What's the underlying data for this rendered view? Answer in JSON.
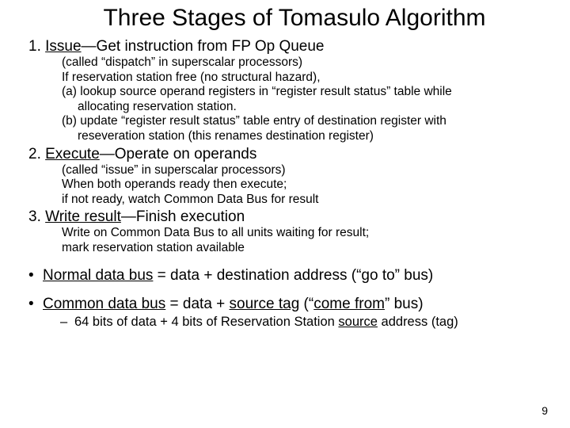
{
  "title": "Three Stages of Tomasulo Algorithm",
  "stage1": {
    "head_pre": "1. ",
    "head_u": "Issue",
    "head_post": "—Get instruction from FP Op Queue",
    "l1": "(called “dispatch” in superscalar processors)",
    "l2": "If reservation station free (no structural hazard),",
    "l3": "(a) lookup source operand registers in “register result status” table while",
    "l3b": "allocating reservation station.",
    "l4": "(b) update “register result status” table entry of destination register with",
    "l4b": "reseveration station (this renames destination register)"
  },
  "stage2": {
    "head_pre": "2. ",
    "head_u": "Execute",
    "head_post": "—Operate on operands",
    "l1": "(called “issue” in superscalar processors)",
    "l2": "When both operands ready then execute;",
    "l3": "if not ready, watch Common Data Bus for result"
  },
  "stage3": {
    "head_pre": "3. ",
    "head_u": "Write result",
    "head_post": "—Finish execution",
    "l1": "Write on Common Data Bus to all units waiting for result;",
    "l2": "mark reservation station available"
  },
  "bullet1": {
    "pre": "",
    "u": "Normal data bus",
    "post": " = data + destination address (“go to” bus)"
  },
  "bullet2": {
    "pre": "",
    "u1": "Common data bus",
    "mid1": " = data + ",
    "u2": "source tag",
    "mid2": "  (“",
    "u3": "come from",
    "post": "” bus)"
  },
  "subbullet": {
    "pre": "64 bits of data + 4 bits of Reservation Station ",
    "u": "source",
    "post": " address (tag)"
  },
  "pagenum": "9"
}
